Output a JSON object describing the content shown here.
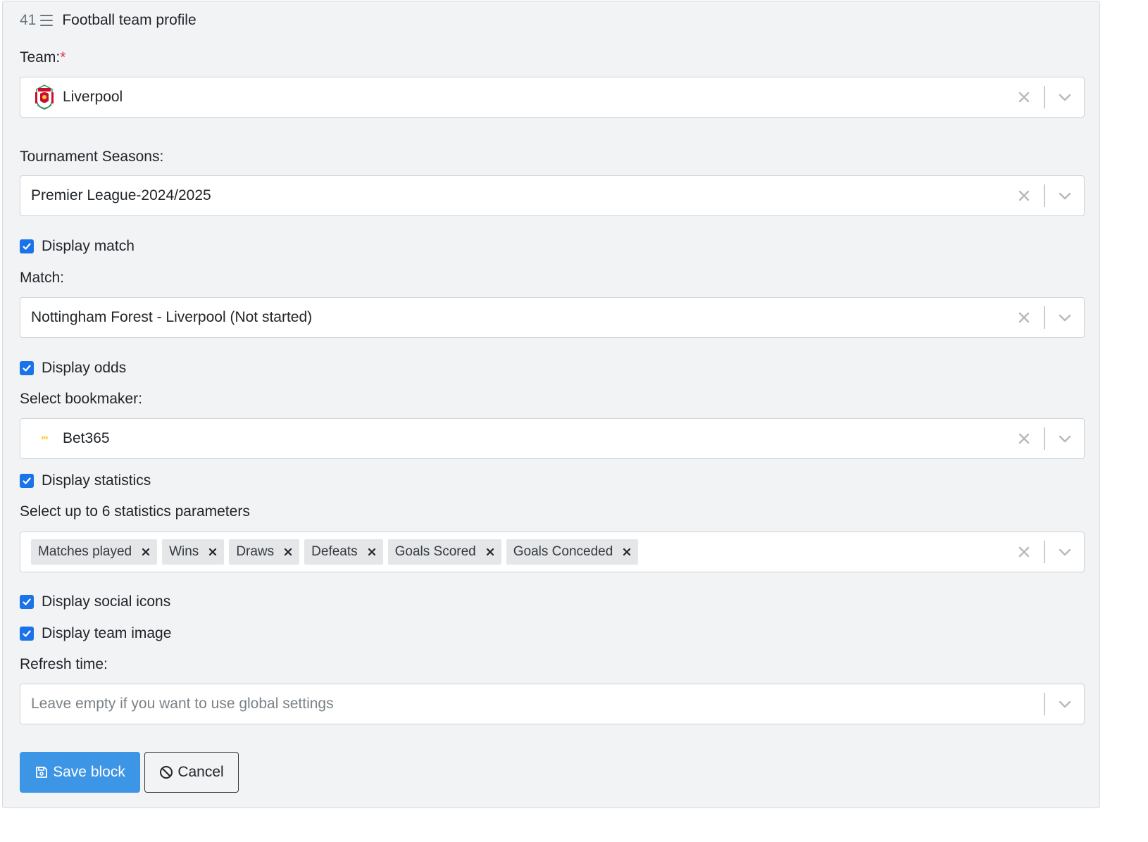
{
  "header": {
    "block_id": "41",
    "title": "Football team profile"
  },
  "team": {
    "label": "Team:",
    "required_mark": "*",
    "value": "Liverpool"
  },
  "tournament": {
    "label": "Tournament Seasons:",
    "value": "Premier League-2024/2025"
  },
  "display_match": {
    "label": "Display match",
    "checked": true
  },
  "match": {
    "label": "Match:",
    "value": "Nottingham Forest - Liverpool (Not started)"
  },
  "display_odds": {
    "label": "Display odds",
    "checked": true
  },
  "bookmaker": {
    "label": "Select bookmaker:",
    "value": "Bet365",
    "logo_text": "365"
  },
  "display_statistics": {
    "label": "Display statistics",
    "checked": true
  },
  "statistics": {
    "label": "Select up to 6 statistics parameters",
    "tags": [
      "Matches played",
      "Wins",
      "Draws",
      "Defeats",
      "Goals Scored",
      "Goals Conceded"
    ]
  },
  "display_social": {
    "label": "Display social icons",
    "checked": true
  },
  "display_team_image": {
    "label": "Display team image",
    "checked": true
  },
  "refresh": {
    "label": "Refresh time:",
    "placeholder": "Leave empty if you want to use global settings"
  },
  "actions": {
    "save_label": "Save block",
    "cancel_label": "Cancel"
  },
  "colors": {
    "primary": "#3d95e6",
    "checkbox": "#1a73e8",
    "required": "#dc3545",
    "panel_bg": "#f1f3f5"
  },
  "icons": {
    "menu": "menu-icon",
    "clear": "clear-icon",
    "dropdown": "chevron-down-icon",
    "save": "floppy-disk-icon",
    "cancel": "ban-icon"
  }
}
